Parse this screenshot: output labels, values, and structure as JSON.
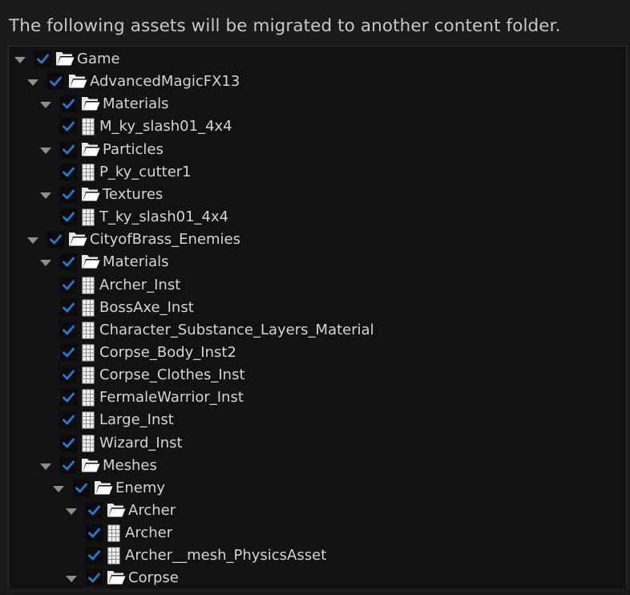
{
  "dialog": {
    "header": "The following assets will be migrated to another content folder."
  },
  "colors": {
    "accent": "#1d7fe0",
    "text": "#d4d4d4",
    "background": "#121212"
  },
  "tree": [
    {
      "label": "Game",
      "type": "folder",
      "depth": 0,
      "checked": true,
      "expanded": true
    },
    {
      "label": "AdvancedMagicFX13",
      "type": "folder",
      "depth": 1,
      "checked": true,
      "expanded": true
    },
    {
      "label": "Materials",
      "type": "folder",
      "depth": 2,
      "checked": true,
      "expanded": true
    },
    {
      "label": "M_ky_slash01_4x4",
      "type": "file",
      "depth": 3,
      "checked": true
    },
    {
      "label": "Particles",
      "type": "folder",
      "depth": 2,
      "checked": true,
      "expanded": true
    },
    {
      "label": "P_ky_cutter1",
      "type": "file",
      "depth": 3,
      "checked": true
    },
    {
      "label": "Textures",
      "type": "folder",
      "depth": 2,
      "checked": true,
      "expanded": true
    },
    {
      "label": "T_ky_slash01_4x4",
      "type": "file",
      "depth": 3,
      "checked": true
    },
    {
      "label": "CityofBrass_Enemies",
      "type": "folder",
      "depth": 1,
      "checked": true,
      "expanded": true
    },
    {
      "label": "Materials",
      "type": "folder",
      "depth": 2,
      "checked": true,
      "expanded": true
    },
    {
      "label": "Archer_Inst",
      "type": "file",
      "depth": 3,
      "checked": true
    },
    {
      "label": "BossAxe_Inst",
      "type": "file",
      "depth": 3,
      "checked": true
    },
    {
      "label": "Character_Substance_Layers_Material",
      "type": "file",
      "depth": 3,
      "checked": true
    },
    {
      "label": "Corpse_Body_Inst2",
      "type": "file",
      "depth": 3,
      "checked": true
    },
    {
      "label": "Corpse_Clothes_Inst",
      "type": "file",
      "depth": 3,
      "checked": true
    },
    {
      "label": "FermaleWarrior_Inst",
      "type": "file",
      "depth": 3,
      "checked": true
    },
    {
      "label": "Large_Inst",
      "type": "file",
      "depth": 3,
      "checked": true
    },
    {
      "label": "Wizard_Inst",
      "type": "file",
      "depth": 3,
      "checked": true
    },
    {
      "label": "Meshes",
      "type": "folder",
      "depth": 2,
      "checked": true,
      "expanded": true
    },
    {
      "label": "Enemy",
      "type": "folder",
      "depth": 3,
      "checked": true,
      "expanded": true
    },
    {
      "label": "Archer",
      "type": "folder",
      "depth": 4,
      "checked": true,
      "expanded": true
    },
    {
      "label": "Archer",
      "type": "file",
      "depth": 5,
      "checked": true
    },
    {
      "label": "Archer__mesh_PhysicsAsset",
      "type": "file",
      "depth": 5,
      "checked": true
    },
    {
      "label": "Corpse",
      "type": "folder",
      "depth": 4,
      "checked": true,
      "expanded": true
    }
  ]
}
